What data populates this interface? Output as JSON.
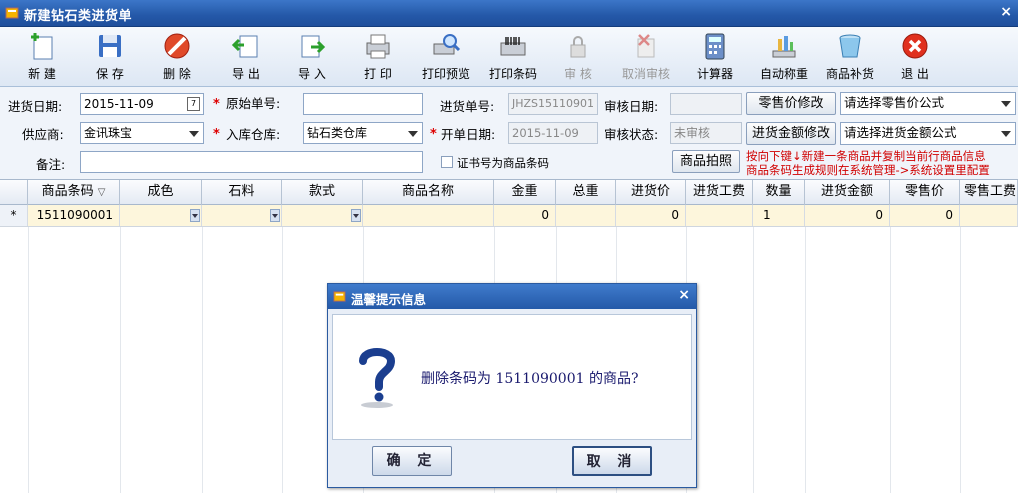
{
  "window": {
    "title": "新建钻石类进货单",
    "close": "×"
  },
  "toolbar": [
    {
      "label": "新 建",
      "icon": "new-icon",
      "enabled": true
    },
    {
      "label": "保 存",
      "icon": "save-icon",
      "enabled": true
    },
    {
      "label": "删 除",
      "icon": "delete-icon",
      "enabled": true
    },
    {
      "label": "导 出",
      "icon": "export-icon",
      "enabled": true
    },
    {
      "label": "导 入",
      "icon": "import-icon",
      "enabled": true
    },
    {
      "label": "打 印",
      "icon": "print-icon",
      "enabled": true
    },
    {
      "label": "打印预览",
      "icon": "print-preview-icon",
      "enabled": true
    },
    {
      "label": "打印条码",
      "icon": "barcode-printer-icon",
      "enabled": true
    },
    {
      "label": "审 核",
      "icon": "lock-icon",
      "enabled": false
    },
    {
      "label": "取消审核",
      "icon": "cancel-audit-icon",
      "enabled": false
    },
    {
      "label": "计算器",
      "icon": "calculator-icon",
      "enabled": true
    },
    {
      "label": "自动称重",
      "icon": "scale-icon",
      "enabled": true
    },
    {
      "label": "商品补货",
      "icon": "bucket-icon",
      "enabled": true
    },
    {
      "label": "退 出",
      "icon": "exit-icon",
      "enabled": true
    }
  ],
  "form": {
    "purchase_date": {
      "label": "进货日期:",
      "value": "2015-11-09",
      "cal": "7"
    },
    "original_no": {
      "label": "原始单号:",
      "value": ""
    },
    "purchase_no": {
      "label": "进货单号:",
      "value": "JHZS15110901"
    },
    "audit_date": {
      "label": "审核日期:",
      "value": ""
    },
    "retail_edit_btn": "零售价修改",
    "retail_formula": "请选择零售价公式",
    "supplier": {
      "label": "供应商:",
      "value": "金讯珠宝"
    },
    "warehouse": {
      "label": "入库仓库:",
      "value": "钻石类仓库"
    },
    "open_date": {
      "label": "开单日期:",
      "value": "2015-11-09"
    },
    "audit_status": {
      "label": "审核状态:",
      "value": "未审核"
    },
    "amount_edit_btn": "进货金额修改",
    "amount_formula": "请选择进货金额公式",
    "remark": {
      "label": "备注:",
      "value": ""
    },
    "cert_checkbox_label": "证书号为商品条码",
    "photo_btn": "商品拍照",
    "required_mark": "*",
    "hint_line1": "按向下键↓新建一条商品并复制当前行商品信息",
    "hint_line2": "商品条码生成规则在系统管理->系统设置里配置"
  },
  "grid": {
    "columns": [
      "商品条码",
      "成色",
      "石料",
      "款式",
      "商品名称",
      "金重",
      "总重",
      "进货价",
      "进货工费",
      "数量",
      "进货金额",
      "零售价",
      "零售工费"
    ],
    "sort_icon": "▽",
    "row_marker": "*",
    "rows": [
      {
        "barcode": "1511090001",
        "gold_weight": "0",
        "purchase_price": "0",
        "qty": "1",
        "amount": "0",
        "retail": "0"
      }
    ]
  },
  "dialog": {
    "title": "温馨提示信息",
    "close": "×",
    "message": "删除条码为 1511090001 的商品?",
    "ok": "确 定",
    "cancel": "取 消"
  },
  "colors": {
    "titlebar": "#2458a8",
    "hint": "#d00000",
    "row_highlight": "#fdf6dc"
  }
}
